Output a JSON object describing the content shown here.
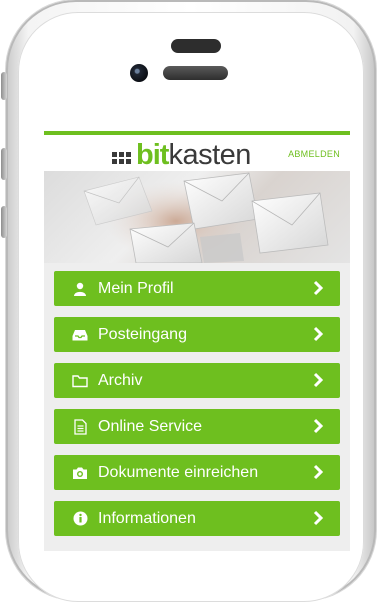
{
  "header": {
    "logo_bit": "bit",
    "logo_kasten": "kasten",
    "logout_label": "ABMELDEN"
  },
  "menu": {
    "items": [
      {
        "label": "Mein Profil",
        "icon": "user-icon"
      },
      {
        "label": "Posteingang",
        "icon": "inbox-icon"
      },
      {
        "label": "Archiv",
        "icon": "folder-icon"
      },
      {
        "label": "Online Service",
        "icon": "document-icon"
      },
      {
        "label": "Dokumente einreichen",
        "icon": "camera-icon"
      },
      {
        "label": "Informationen",
        "icon": "info-icon"
      }
    ]
  },
  "colors": {
    "brand_green": "#6ebf1f",
    "logo_dark": "#3a3a3a",
    "screen_bg": "#eeeeee"
  }
}
